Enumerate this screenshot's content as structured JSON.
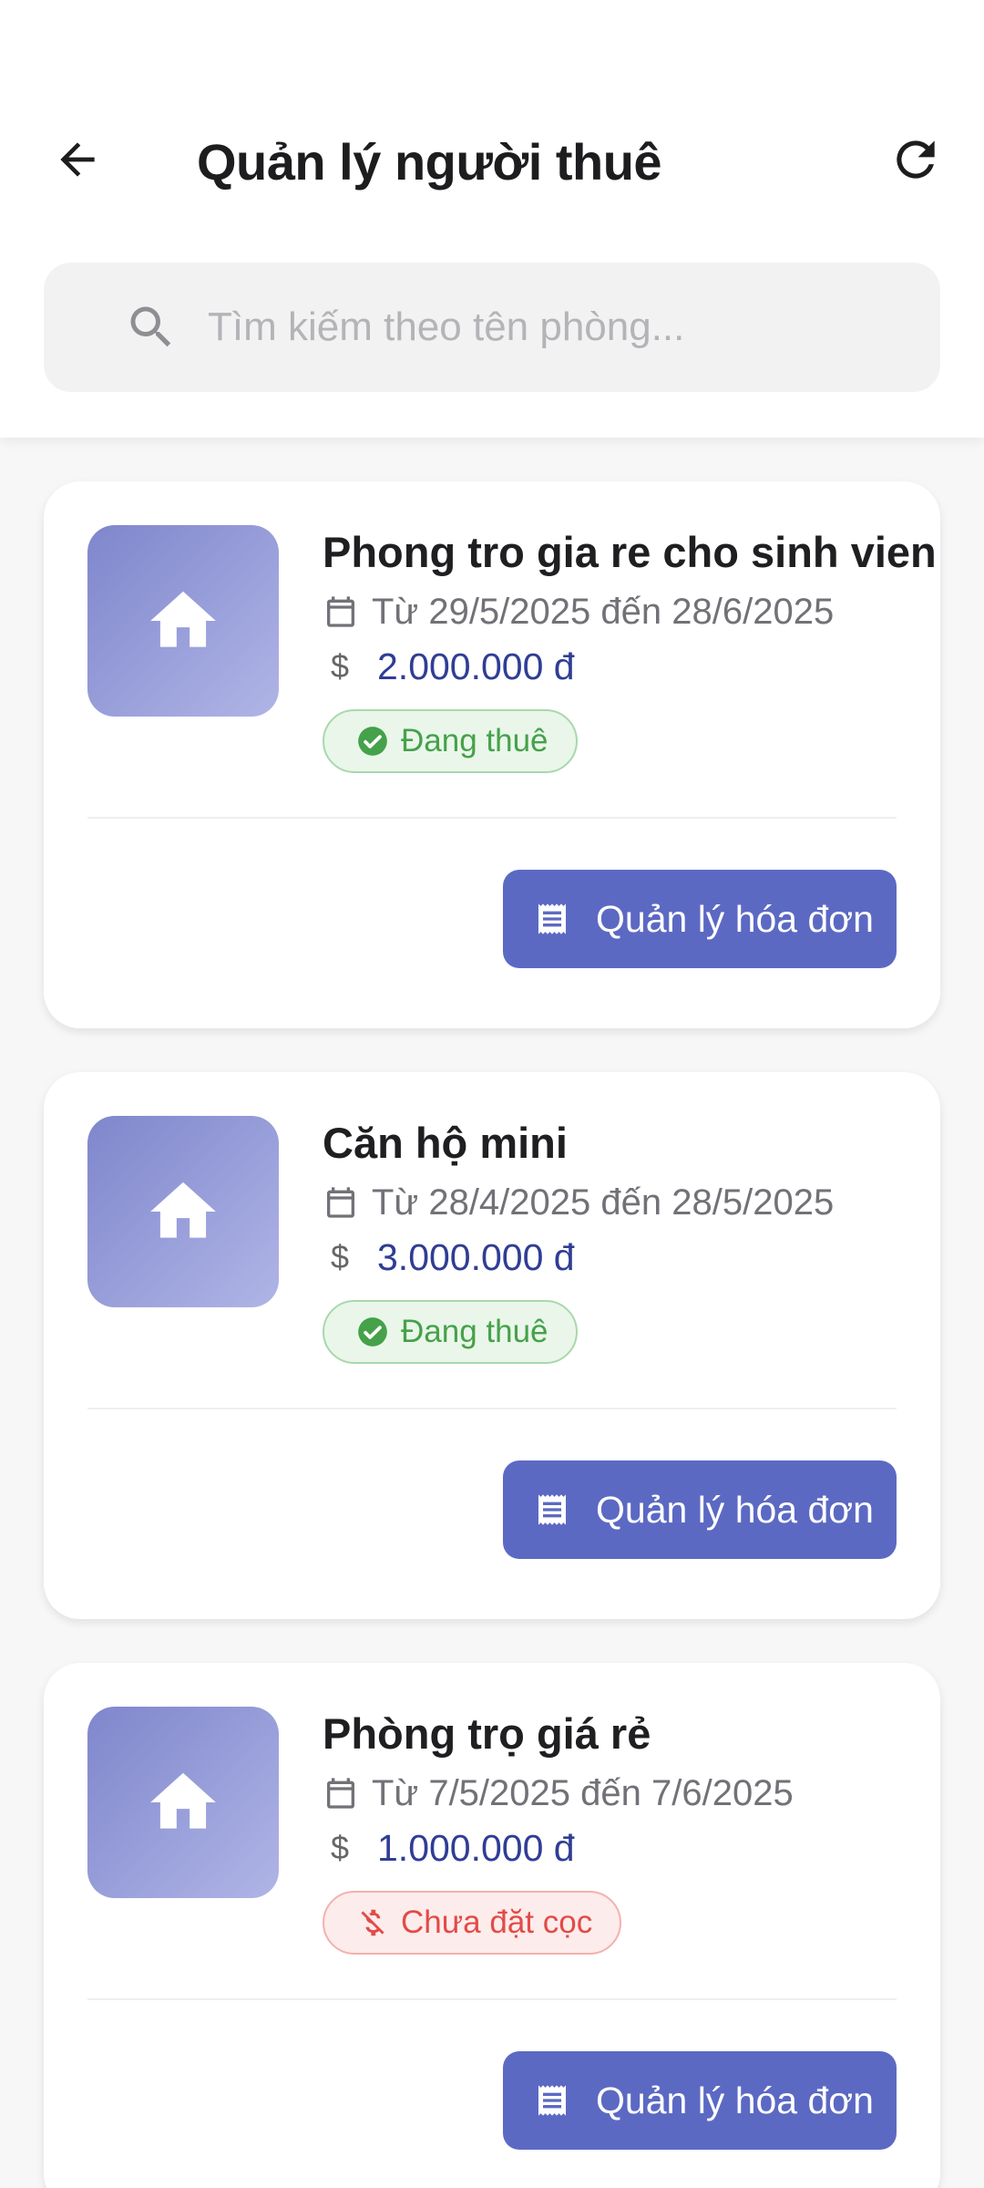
{
  "header": {
    "title": "Quản lý người thuê",
    "back_icon": "arrow-back-icon",
    "refresh_icon": "refresh-icon"
  },
  "search": {
    "placeholder": "Tìm kiếm theo tên phòng...",
    "value": ""
  },
  "tenancies": [
    {
      "name": "Phong tro gia re cho sinh vien",
      "date_range": "Từ 29/5/2025 đến 28/6/2025",
      "price": "2.000.000 đ",
      "status": "Đang thuê",
      "status_kind": "active",
      "status_icon": "check-circle-icon",
      "action_label": "Quản lý hóa đơn"
    },
    {
      "name": "Căn hộ mini",
      "date_range": "Từ 28/4/2025 đến 28/5/2025",
      "price": "3.000.000 đ",
      "status": "Đang thuê",
      "status_kind": "active",
      "status_icon": "check-circle-icon",
      "action_label": "Quản lý hóa đơn"
    },
    {
      "name": "Phòng trọ giá rẻ",
      "date_range": "Từ 7/5/2025 đến 7/6/2025",
      "price": "1.000.000 đ",
      "status": "Chưa đặt cọc",
      "status_kind": "unpaid",
      "status_icon": "money-off-icon",
      "action_label": "Quản lý hóa đơn"
    }
  ],
  "colors": {
    "primary": "#5c69c3",
    "price_text": "#2f3d94",
    "active_green": "#45a14a",
    "unpaid_red": "#e24b47",
    "thumb_gradient_start": "#7f86cc",
    "thumb_gradient_end": "#b0b5e6"
  }
}
